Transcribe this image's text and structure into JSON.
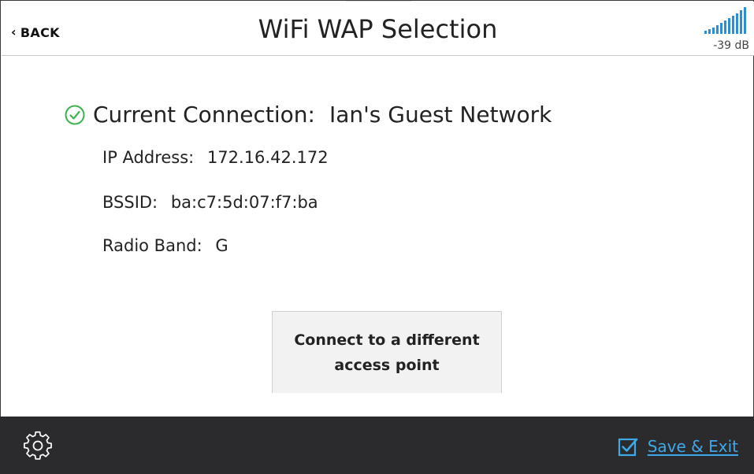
{
  "header": {
    "back_label": "BACK",
    "title": "WiFi WAP Selection",
    "signal_db": "-39 dB"
  },
  "connection": {
    "label": "Current Connection:",
    "network_name": "Ian's Guest Network",
    "ip_label": "IP Address:",
    "ip_value": "172.16.42.172",
    "bssid_label": "BSSID:",
    "bssid_value": "ba:c7:5d:07:f7:ba",
    "band_label": "Radio Band:",
    "band_value": "G"
  },
  "actions": {
    "connect_different_label": "Connect to a different access point"
  },
  "footer": {
    "save_exit_label": "Save & Exit"
  },
  "icons": {
    "back": "chevron-left-icon",
    "signal": "signal-strength-icon",
    "connected": "check-circle-icon",
    "settings": "gear-icon",
    "save": "checkbox-checked-icon"
  },
  "colors": {
    "connected_green": "#3fb24f",
    "signal_blue": "#2a8fd8",
    "footer_background": "#2b2b2d",
    "save_link_blue": "#3ea9e8"
  }
}
